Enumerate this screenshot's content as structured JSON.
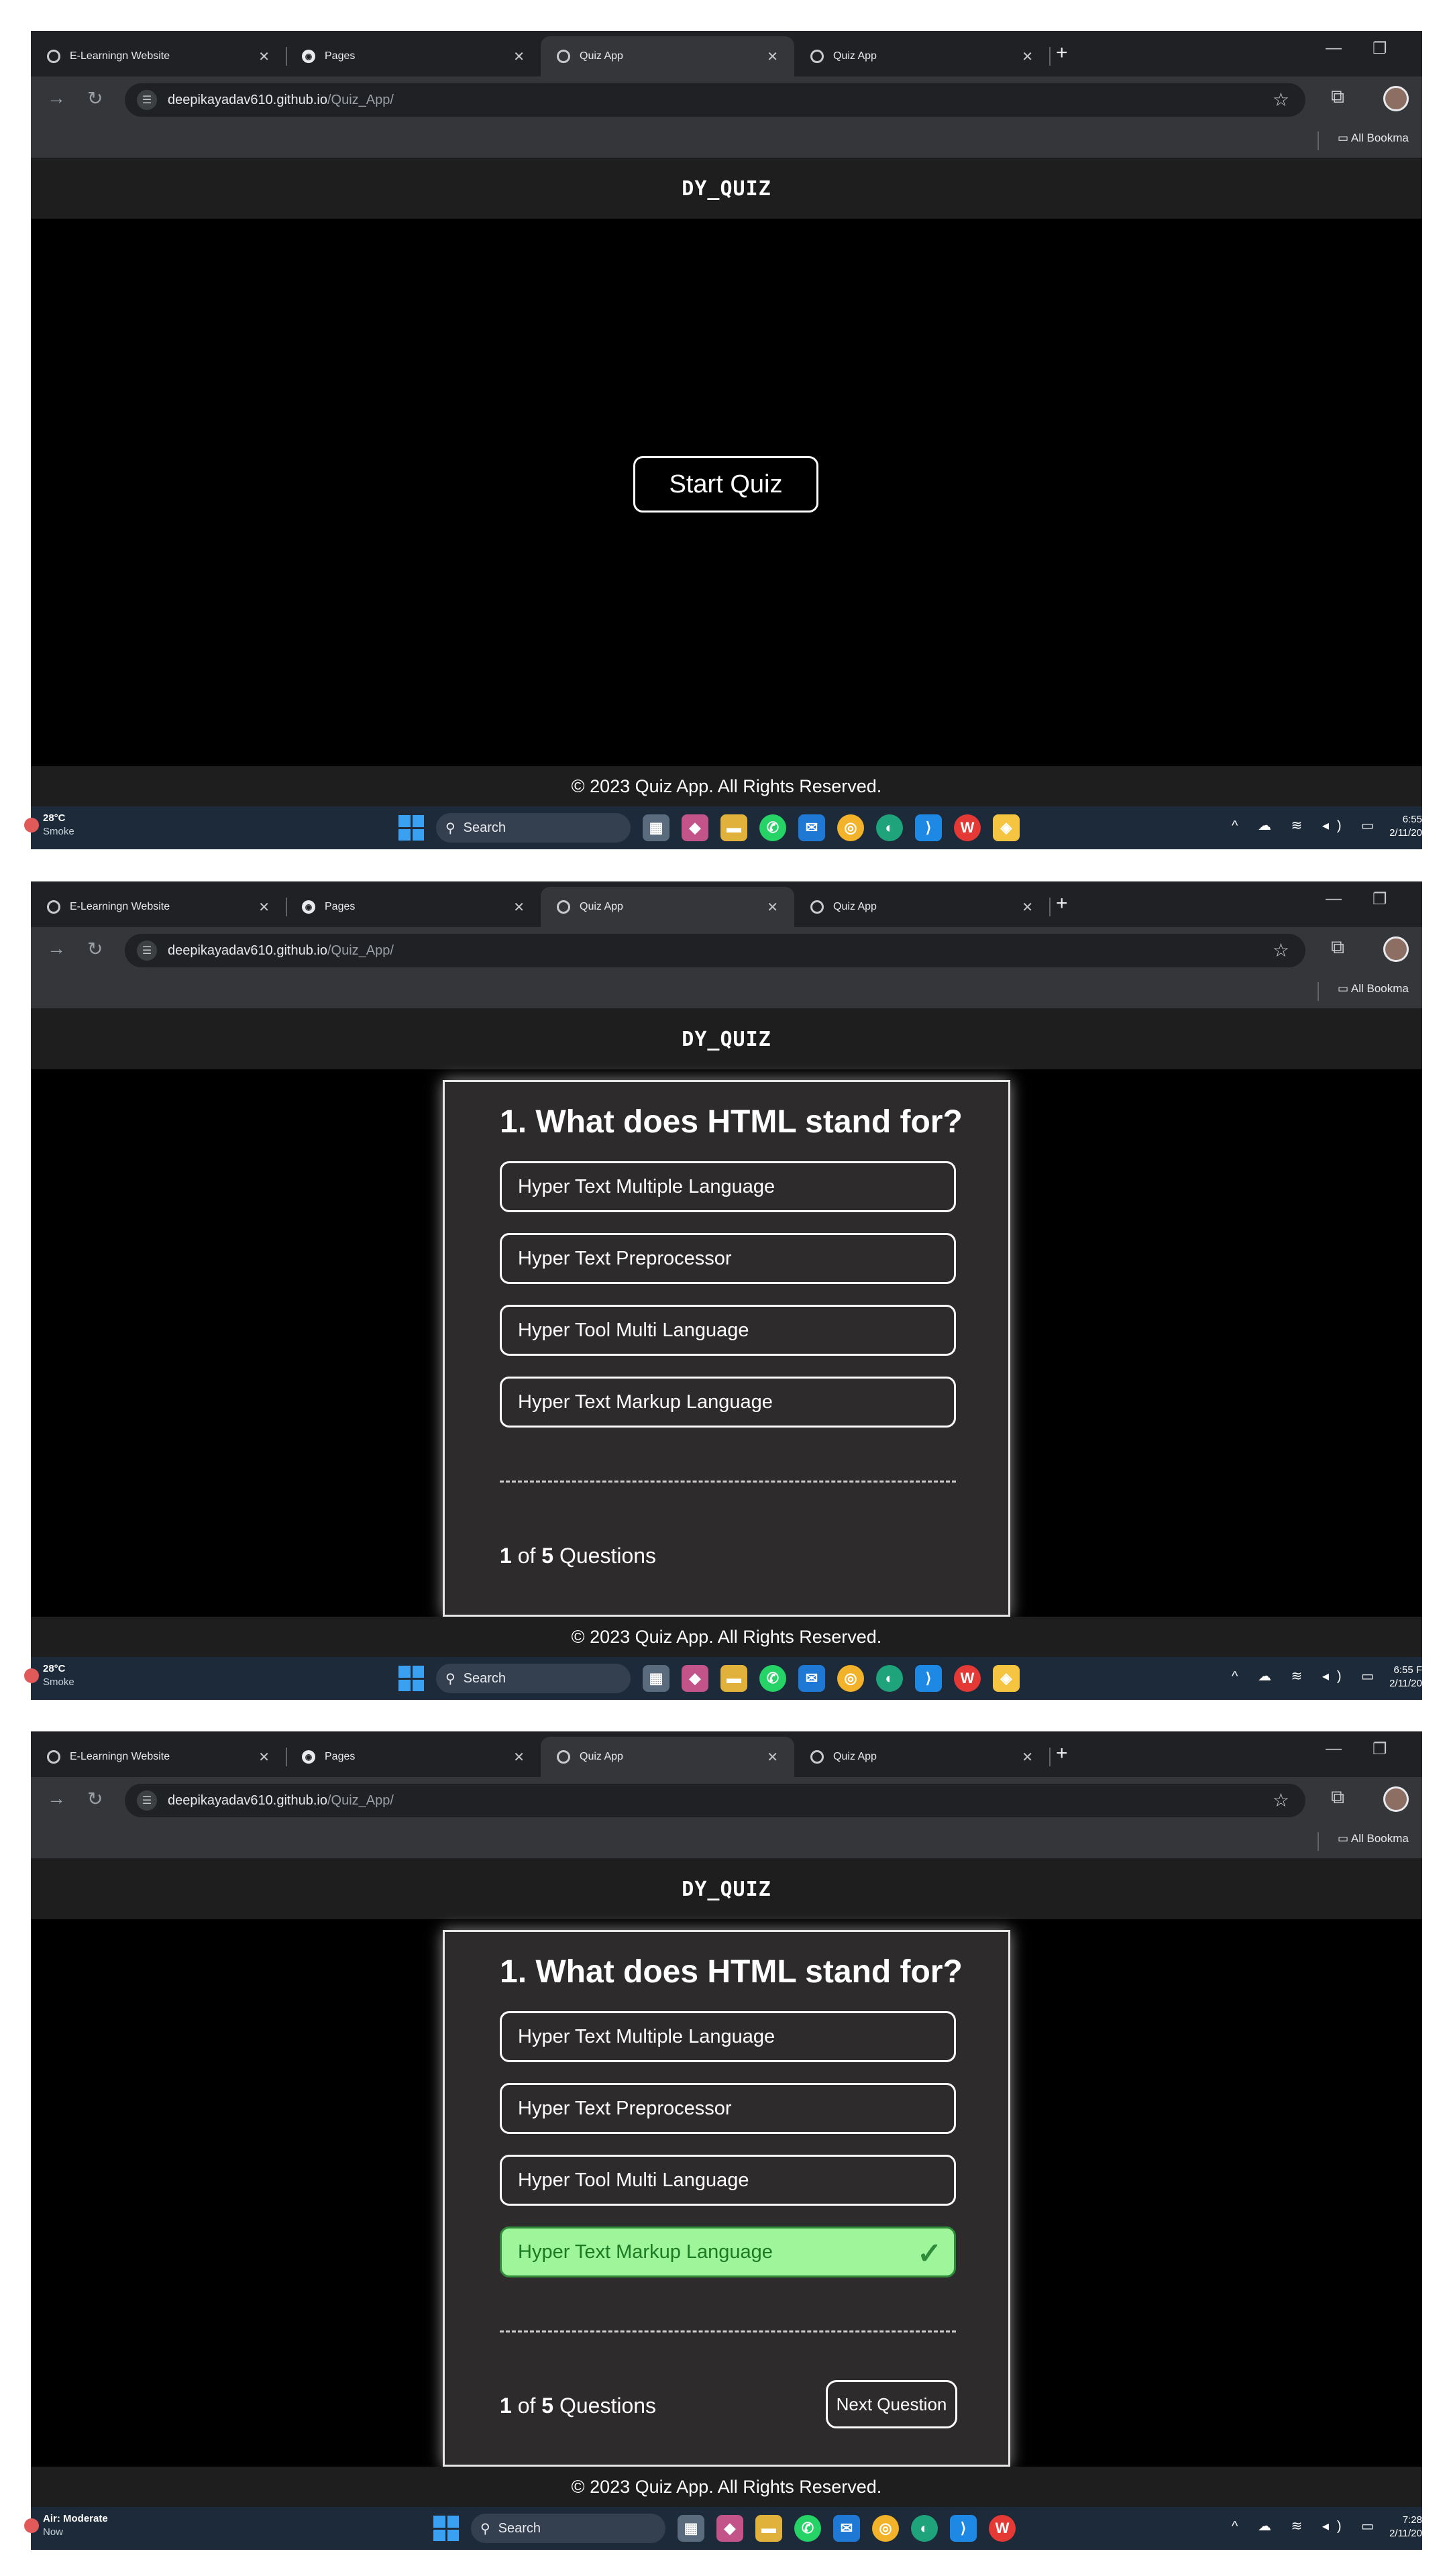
{
  "browser": {
    "tabs": [
      {
        "label": "E-Learningn Website",
        "icon": "globe-icon"
      },
      {
        "label": "Pages",
        "icon": "github-icon"
      },
      {
        "label": "Quiz App",
        "icon": "globe-icon"
      },
      {
        "label": "Quiz App",
        "icon": "globe-icon"
      }
    ],
    "url_host": "deepikayadav610.github.io",
    "url_path": "/Quiz_App/",
    "bookmark_label": "All Bookma",
    "new_tab_glyph": "+",
    "close_glyph": "✕"
  },
  "app": {
    "brand": "DY_QUIZ",
    "start_label": "Start Quiz",
    "question": "1. What does HTML stand for?",
    "answers": [
      "Hyper Text Multiple Language",
      "Hyper Text Preprocessor",
      "Hyper Tool Multi Language",
      "Hyper Text Markup Language"
    ],
    "progress": {
      "current": "1",
      "of": "of",
      "total": "5",
      "suffix": "Questions"
    },
    "next_label": "Next Question",
    "footer": "© 2023 Quiz App. All Rights Reserved."
  },
  "taskbar": {
    "search_label": "Search",
    "shots": [
      {
        "weather_main": "28°C",
        "weather_sub": "Smoke",
        "time": "6:55",
        "date": "2/11/20"
      },
      {
        "weather_main": "28°C",
        "weather_sub": "Smoke",
        "time": "6:55 F",
        "date": "2/11/20"
      },
      {
        "weather_main": "Air: Moderate",
        "weather_sub": "Now",
        "time": "7:28",
        "date": "2/11/20"
      }
    ]
  },
  "colors": {
    "correct_bg": "#9ef59a",
    "correct_text": "#1b7a24",
    "card_bg": "#2d2b2c"
  }
}
